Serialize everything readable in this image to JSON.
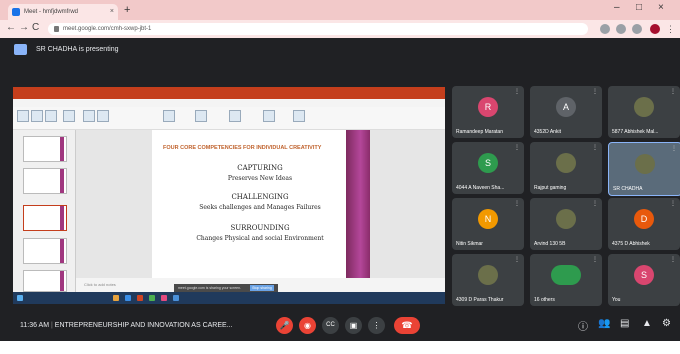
{
  "browser": {
    "tab_title": "Meet - hmfjdwmfrwd",
    "new_tab": "+",
    "url": "meet.google.com/cmh-sxwp-jbt-1",
    "win_min": "–",
    "win_max": "□",
    "win_close": "×",
    "back": "←",
    "forward": "→",
    "reload": "C"
  },
  "meet": {
    "presenting_text": "SR CHADHA is presenting",
    "meeting_time": "11:36 AM",
    "meeting_name": "ENTREPRENEURSHIP AND INNOVATION AS CAREE...",
    "accent": "#ea4335"
  },
  "slide": {
    "title": "FOUR CORE COMPETENCIES FOR INDIVIDUAL CREATIVITY",
    "items": [
      {
        "head": "CAPTURING",
        "sub": "Preserves New Ideas"
      },
      {
        "head": "CHALLENGING",
        "sub": "Seeks challenges and Manages Failures"
      },
      {
        "head": "SURROUNDING",
        "sub": "Changes Physical and social Environment"
      }
    ],
    "notes_placeholder": "Click to add notes",
    "share_text": "meet.google.com is sharing your screen.",
    "stop_share": "Stop sharing"
  },
  "participants": [
    {
      "initial": "R",
      "name": "Ramandeep Maratan",
      "color": "#d9466f"
    },
    {
      "initial": "A",
      "name": "4352D Ankit",
      "color": "#5f6368"
    },
    {
      "initial": "",
      "name": "5877 Abhishek Mal...",
      "color": "#5f6368",
      "photo": true
    },
    {
      "initial": "S",
      "name": "4044 A Naveen Sha...",
      "color": "#2e9b4e"
    },
    {
      "initial": "",
      "name": "Rajput gaming",
      "color": "#5f6368",
      "photo": true
    },
    {
      "initial": "",
      "name": "SR CHADHA",
      "color": "#5f6368",
      "photo": true,
      "highlight": true
    },
    {
      "initial": "N",
      "name": "Nitin Sikmar",
      "color": "#f29900"
    },
    {
      "initial": "",
      "name": "Arvind 130 5B",
      "color": "#5f6368",
      "photo": true
    },
    {
      "initial": "D",
      "name": "4375 D Abhishek",
      "color": "#e8590c"
    },
    {
      "initial": "",
      "name": "4309 D Paras Thakur",
      "color": "#5f6368",
      "photo": true
    },
    {
      "initial": "",
      "name": "16 others",
      "color": "#2e9b4e",
      "group": true
    },
    {
      "initial": "S",
      "name": "You",
      "color": "#d9466f"
    }
  ],
  "controls": {
    "mic": "🎤",
    "cam": "◉",
    "captions": "CC",
    "present": "▣",
    "more": "⋮",
    "end": "☎"
  }
}
